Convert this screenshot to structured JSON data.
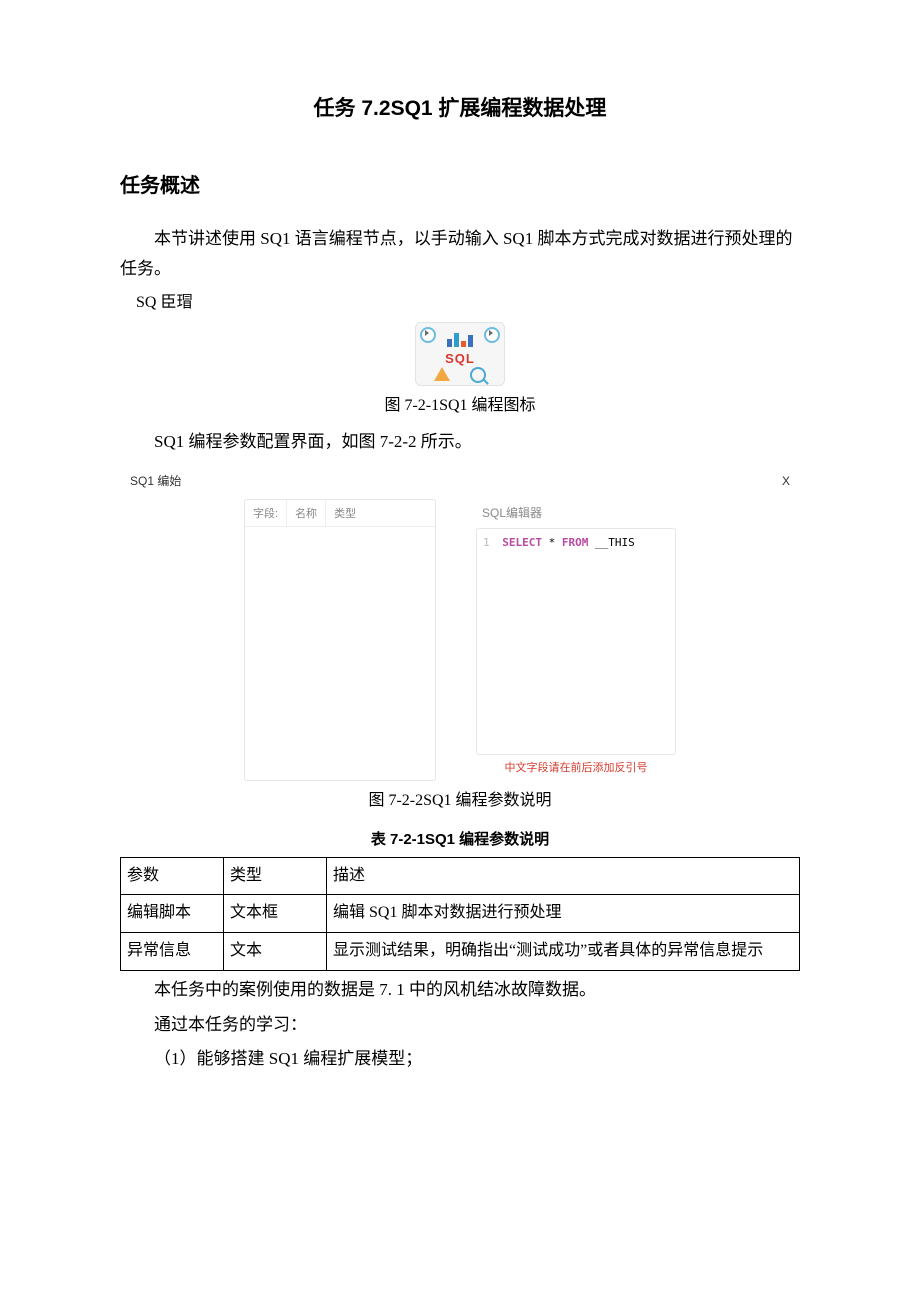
{
  "title": "任务 7.2SQ1 扩展编程数据处理",
  "heading1": "任务概述",
  "para1": "本节讲述使用 SQ1 语言编程节点，以手动输入 SQ1 脚本方式完成对数据进行预处理的任务。",
  "sq_label": "SQ 臣瑁",
  "caption1": "图 7-2-1SQ1 编程图标",
  "para2": "SQ1 编程参数配置界面，如图 7-2-2 所示。",
  "dialog_title": "SQ1 编始",
  "dialog_close": "X",
  "fields_header": {
    "c1": "字段:",
    "c2": "名称",
    "c3": "类型"
  },
  "editor_title": "SQL编辑器",
  "editor_code": {
    "lineno": "1",
    "kw1": "SELECT",
    "star": "*",
    "kw2": "FROM",
    "tail": "__THIS"
  },
  "editor_hint": "中文字段请在前后添加反引号",
  "caption2": "图 7-2-2SQ1 编程参数说明",
  "caption3": "表 7-2-1SQ1 编程参数说明",
  "table": {
    "head": {
      "c1": "参数",
      "c2": "类型",
      "c3": "描述"
    },
    "rows": [
      {
        "c1": "编辑脚本",
        "c2": "文本框",
        "c3": "编辑 SQ1 脚本对数据进行预处理"
      },
      {
        "c1": "异常信息",
        "c2": "文本",
        "c3": "显示测试结果，明确指出“测试成功”或者具体的异常信息提示"
      }
    ]
  },
  "para3": "本任务中的案例使用的数据是 7. 1 中的风机结冰故障数据。",
  "para4": "通过本任务的学习：",
  "para5": "（1）能够搭建 SQ1 编程扩展模型；",
  "icon_sql": "SQL"
}
